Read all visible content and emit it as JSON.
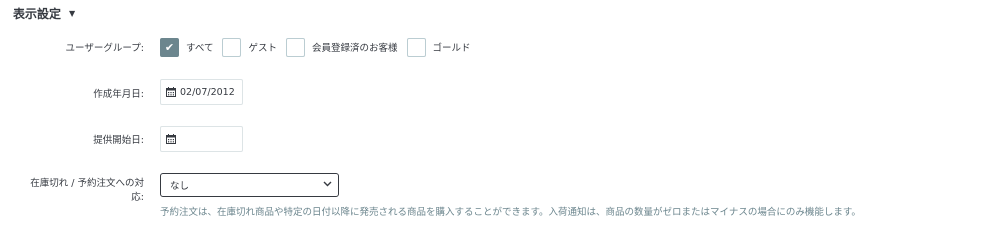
{
  "section": {
    "title": "表示設定",
    "caret": "▼"
  },
  "user_group": {
    "label": "ユーザーグループ:",
    "options": [
      {
        "label": "すべて",
        "checked": true
      },
      {
        "label": "ゲスト",
        "checked": false
      },
      {
        "label": "会員登録済のお客様",
        "checked": false
      },
      {
        "label": "ゴールド",
        "checked": false
      }
    ]
  },
  "created_date": {
    "label": "作成年月日:",
    "value": "02/07/2012",
    "icon": "calendar-icon"
  },
  "available_date": {
    "label": "提供開始日:",
    "value": "",
    "icon": "calendar-icon"
  },
  "out_of_stock": {
    "label_line1": "在庫切れ / 予約注文への対",
    "label_line2": "応:",
    "selected": "なし",
    "help": "予約注文は、在庫切れ商品や特定の日付以降に発売される商品を購入することができます。入荷通知は、商品の数量がゼロまたはマイナスの場合にのみ機能します。"
  },
  "colors": {
    "text": "#363a41",
    "checkbox_checked": "#6c868e",
    "border": "#bbcdd2",
    "help": "#6c868e"
  }
}
